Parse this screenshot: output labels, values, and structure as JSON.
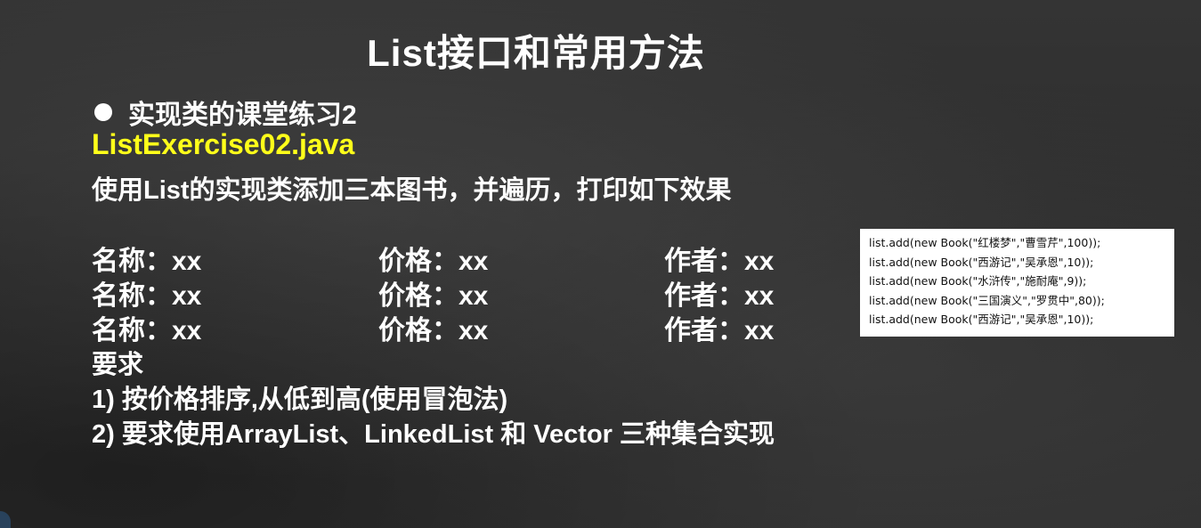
{
  "slide": {
    "title": "List接口和常用方法",
    "bullet": "实现类的课堂练习2",
    "filename": "ListExercise02.java",
    "description": "使用List的实现类添加三本图书，并遍历，打印如下效果",
    "output_rows": [
      {
        "name": "名称：xx",
        "price": "价格：xx",
        "author": "作者：xx"
      },
      {
        "name": "名称：xx",
        "price": "价格：xx",
        "author": "作者：xx"
      },
      {
        "name": "名称：xx",
        "price": "价格：xx",
        "author": "作者：xx"
      }
    ],
    "requirements_heading": "要求",
    "requirements": [
      "1) 按价格排序,从低到高(使用冒泡法)",
      "2) 要求使用ArrayList、LinkedList 和 Vector 三种集合实现"
    ],
    "code_lines": [
      "list.add(new Book(\"红楼梦\",\"曹雪芹\",100));",
      "list.add(new Book(\"西游记\",\"吴承恩\",10));",
      "list.add(new Book(\"水浒传\",\"施耐庵\",9));",
      "list.add(new Book(\"三国演义\",\"罗贯中\",80));",
      "list.add(new Book(\"西游记\",\"吴承恩\",10));"
    ]
  },
  "colors": {
    "background": "#2f2f2f",
    "text": "#ffffff",
    "filename": "#ffff1a",
    "code_box": "#ffffff"
  }
}
